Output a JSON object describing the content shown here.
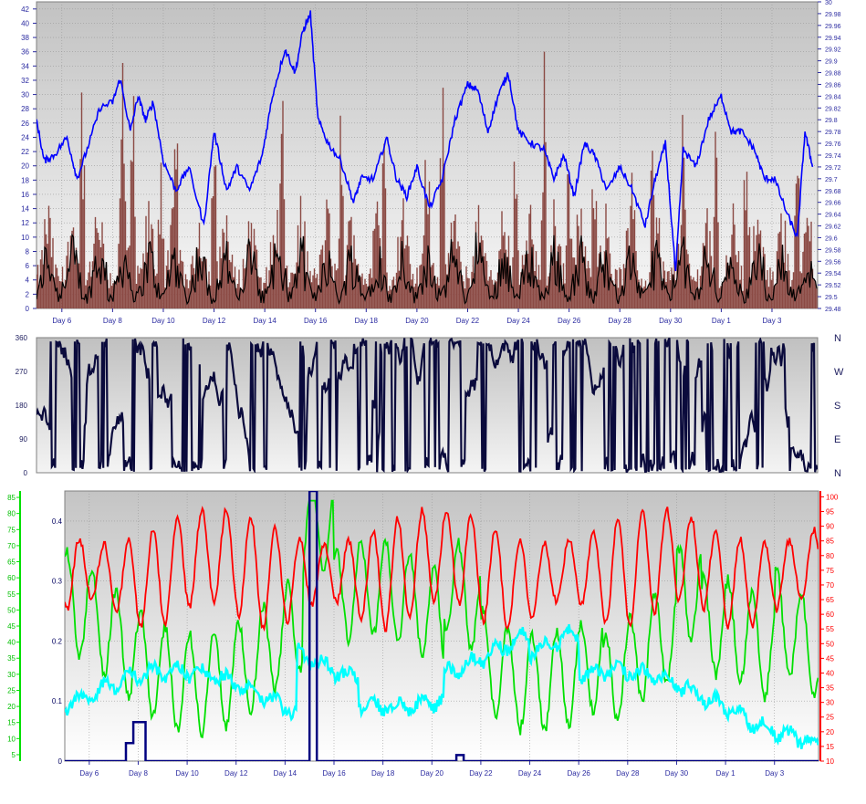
{
  "colors": {
    "wind_gust": "#8b4a44",
    "wind_speed": "#000000",
    "pressure": "#0000ff",
    "direction": "#0a0a3c",
    "temperature": "#ff0000",
    "dewpoint": "#00e000",
    "humidity_blue": "#1f5fff",
    "cyan_series": "#00ffff",
    "rain": "#000080",
    "axis_blue": "#2a2aa0",
    "plot_bg_top": "#c4c4c4",
    "plot_bg_bottom": "#ffffff"
  },
  "day_labels": [
    "Day 6",
    "Day 8",
    "Day 10",
    "Day 12",
    "Day 14",
    "Day 16",
    "Day 18",
    "Day 20",
    "Day 22",
    "Day 24",
    "Day 26",
    "Day 28",
    "Day 30",
    "Day 1",
    "Day 3"
  ],
  "chart_data": [
    {
      "type": "line",
      "panel": "wind",
      "x_ticks": [
        "Day 6",
        "Day 8",
        "Day 10",
        "Day 12",
        "Day 14",
        "Day 16",
        "Day 18",
        "Day 20",
        "Day 22",
        "Day 24",
        "Day 26",
        "Day 28",
        "Day 30",
        "Day 1",
        "Day 3"
      ],
      "ylim_left": [
        0,
        43
      ],
      "y_ticks_left": [
        "0",
        "2",
        "4",
        "6",
        "8",
        "10",
        "12",
        "14",
        "16",
        "18",
        "20",
        "22",
        "24",
        "26",
        "28",
        "30",
        "32",
        "34",
        "36",
        "38",
        "40",
        "42"
      ],
      "ylim_right": [
        29.48,
        30.0
      ],
      "y_ticks_right": [
        "29.48",
        "29.5",
        "29.52",
        "29.54",
        "29.56",
        "29.58",
        "29.6",
        "29.62",
        "29.64",
        "29.66",
        "29.68",
        "29.7",
        "29.72",
        "29.74",
        "29.76",
        "29.78",
        "29.8",
        "29.82",
        "29.84",
        "29.86",
        "29.88",
        "29.9",
        "29.92",
        "29.94",
        "29.96",
        "29.98",
        "30"
      ],
      "grid": true,
      "series": [
        {
          "color_key": "wind_gust",
          "axis": "left",
          "approx_range": [
            0,
            43
          ]
        },
        {
          "color_key": "wind_speed",
          "axis": "left",
          "approx_range": [
            0,
            22
          ]
        },
        {
          "color_key": "pressure",
          "axis": "right",
          "points": [
            [
              5.0,
              29.8
            ],
            [
              5.3,
              29.73
            ],
            [
              5.7,
              29.74
            ],
            [
              6.2,
              29.77
            ],
            [
              6.6,
              29.7
            ],
            [
              7.0,
              29.75
            ],
            [
              7.5,
              29.82
            ],
            [
              8.0,
              29.83
            ],
            [
              8.3,
              29.87
            ],
            [
              8.7,
              29.78
            ],
            [
              9.0,
              29.84
            ],
            [
              9.3,
              29.8
            ],
            [
              9.6,
              29.83
            ],
            [
              10.0,
              29.73
            ],
            [
              10.5,
              29.68
            ],
            [
              11.0,
              29.72
            ],
            [
              11.6,
              29.62
            ],
            [
              12.0,
              29.78
            ],
            [
              12.5,
              29.68
            ],
            [
              12.9,
              29.72
            ],
            [
              13.4,
              29.68
            ],
            [
              13.9,
              29.74
            ],
            [
              14.3,
              29.84
            ],
            [
              14.8,
              29.92
            ],
            [
              15.2,
              29.88
            ],
            [
              15.5,
              29.95
            ],
            [
              15.8,
              29.98
            ],
            [
              16.1,
              29.8
            ],
            [
              16.5,
              29.76
            ],
            [
              17.0,
              29.73
            ],
            [
              17.5,
              29.66
            ],
            [
              17.8,
              29.7
            ],
            [
              18.3,
              29.7
            ],
            [
              18.8,
              29.77
            ],
            [
              19.2,
              29.7
            ],
            [
              19.6,
              29.67
            ],
            [
              20.0,
              29.72
            ],
            [
              20.5,
              29.65
            ],
            [
              21.0,
              29.7
            ],
            [
              21.5,
              29.8
            ],
            [
              22.0,
              29.86
            ],
            [
              22.4,
              29.85
            ],
            [
              22.8,
              29.78
            ],
            [
              23.2,
              29.84
            ],
            [
              23.6,
              29.88
            ],
            [
              24.0,
              29.78
            ],
            [
              24.5,
              29.76
            ],
            [
              25.0,
              29.75
            ],
            [
              25.4,
              29.7
            ],
            [
              25.8,
              29.74
            ],
            [
              26.2,
              29.67
            ],
            [
              26.6,
              29.76
            ],
            [
              27.0,
              29.74
            ],
            [
              27.5,
              29.68
            ],
            [
              28.0,
              29.72
            ],
            [
              28.5,
              29.68
            ],
            [
              29.0,
              29.62
            ],
            [
              29.4,
              29.7
            ],
            [
              29.8,
              29.76
            ],
            [
              30.2,
              29.54
            ],
            [
              30.5,
              29.75
            ],
            [
              31.0,
              29.72
            ],
            [
              31.5,
              29.8
            ],
            [
              32.0,
              29.84
            ],
            [
              32.4,
              29.78
            ],
            [
              32.8,
              29.78
            ],
            [
              33.3,
              29.75
            ],
            [
              33.7,
              29.7
            ],
            [
              34.1,
              29.7
            ],
            [
              34.6,
              29.64
            ],
            [
              35.0,
              29.6
            ],
            [
              35.3,
              29.78
            ],
            [
              35.6,
              29.72
            ]
          ]
        }
      ]
    },
    {
      "type": "line",
      "panel": "wind_direction",
      "ylim": [
        0,
        360
      ],
      "y_ticks": [
        "0",
        "90",
        "180",
        "270",
        "360"
      ],
      "right_labels": [
        "N",
        "E",
        "S",
        "W",
        "N"
      ],
      "series": [
        {
          "color_key": "direction",
          "axis": "left",
          "approx_range": [
            0,
            360
          ]
        }
      ]
    },
    {
      "type": "line",
      "panel": "temperature_humidity_rain",
      "x_ticks": [
        "Day 6",
        "Day 8",
        "Day 10",
        "Day 12",
        "Day 14",
        "Day 16",
        "Day 18",
        "Day 20",
        "Day 22",
        "Day 24",
        "Day 26",
        "Day 28",
        "Day 30",
        "Day 1",
        "Day 3"
      ],
      "ylim_outer_left": [
        3,
        87
      ],
      "y_ticks_outer_left": [
        "5",
        "10",
        "15",
        "20",
        "25",
        "30",
        "35",
        "40",
        "45",
        "50",
        "55",
        "60",
        "65",
        "70",
        "75",
        "80",
        "85"
      ],
      "ylim_inner_left": [
        0,
        0.45
      ],
      "y_ticks_inner_left": [
        "0",
        "0.1",
        "0.2",
        "0.3",
        "0.4"
      ],
      "ylim_right": [
        10,
        102
      ],
      "y_ticks_right": [
        "10",
        "15",
        "20",
        "25",
        "30",
        "35",
        "40",
        "45",
        "50",
        "55",
        "60",
        "65",
        "70",
        "75",
        "80",
        "85",
        "90",
        "95",
        "100"
      ],
      "grid": true,
      "series": [
        {
          "color_key": "temperature",
          "axis": "right",
          "approx_range": [
            57,
            100
          ]
        },
        {
          "color_key": "dewpoint",
          "axis": "outer_left",
          "approx_range": [
            5,
            85
          ]
        },
        {
          "color_key": "cyan_series",
          "axis": "inner_left",
          "approx_range": [
            0.02,
            0.26
          ]
        },
        {
          "color_key": "rain",
          "axis": "inner_left",
          "points": [
            [
              5.0,
              0
            ],
            [
              7.5,
              0
            ],
            [
              7.5,
              0.03
            ],
            [
              7.8,
              0.03
            ],
            [
              7.8,
              0.065
            ],
            [
              8.3,
              0.065
            ],
            [
              8.3,
              0
            ],
            [
              15.0,
              0
            ],
            [
              15.0,
              0.45
            ],
            [
              15.3,
              0.45
            ],
            [
              15.3,
              0
            ],
            [
              21.0,
              0
            ],
            [
              21.0,
              0.01
            ],
            [
              21.3,
              0.01
            ],
            [
              21.3,
              0
            ],
            [
              35.8,
              0
            ]
          ]
        }
      ]
    }
  ]
}
